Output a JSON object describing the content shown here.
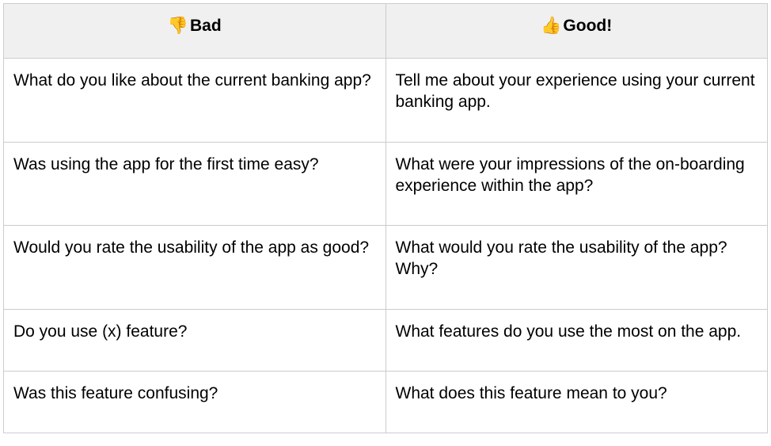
{
  "table": {
    "headers": [
      {
        "emoji": "👎",
        "label": "Bad"
      },
      {
        "emoji": "👍",
        "label": "Good!"
      }
    ],
    "rows": [
      {
        "bad": "What do you like about the current banking app?",
        "good": "Tell me about your experience using your current banking app."
      },
      {
        "bad": "Was using the app for the first time easy?",
        "good": "What were your impressions of the on-boarding experience within the app?"
      },
      {
        "bad": "Would you rate the usability of the app as good?",
        "good": "What would you rate the usability of the app? Why?"
      },
      {
        "bad": "Do you use (x) feature?",
        "good": "What features do you use the most on the app."
      },
      {
        "bad": "Was this feature confusing?",
        "good": "What does this feature mean to you?"
      }
    ]
  }
}
